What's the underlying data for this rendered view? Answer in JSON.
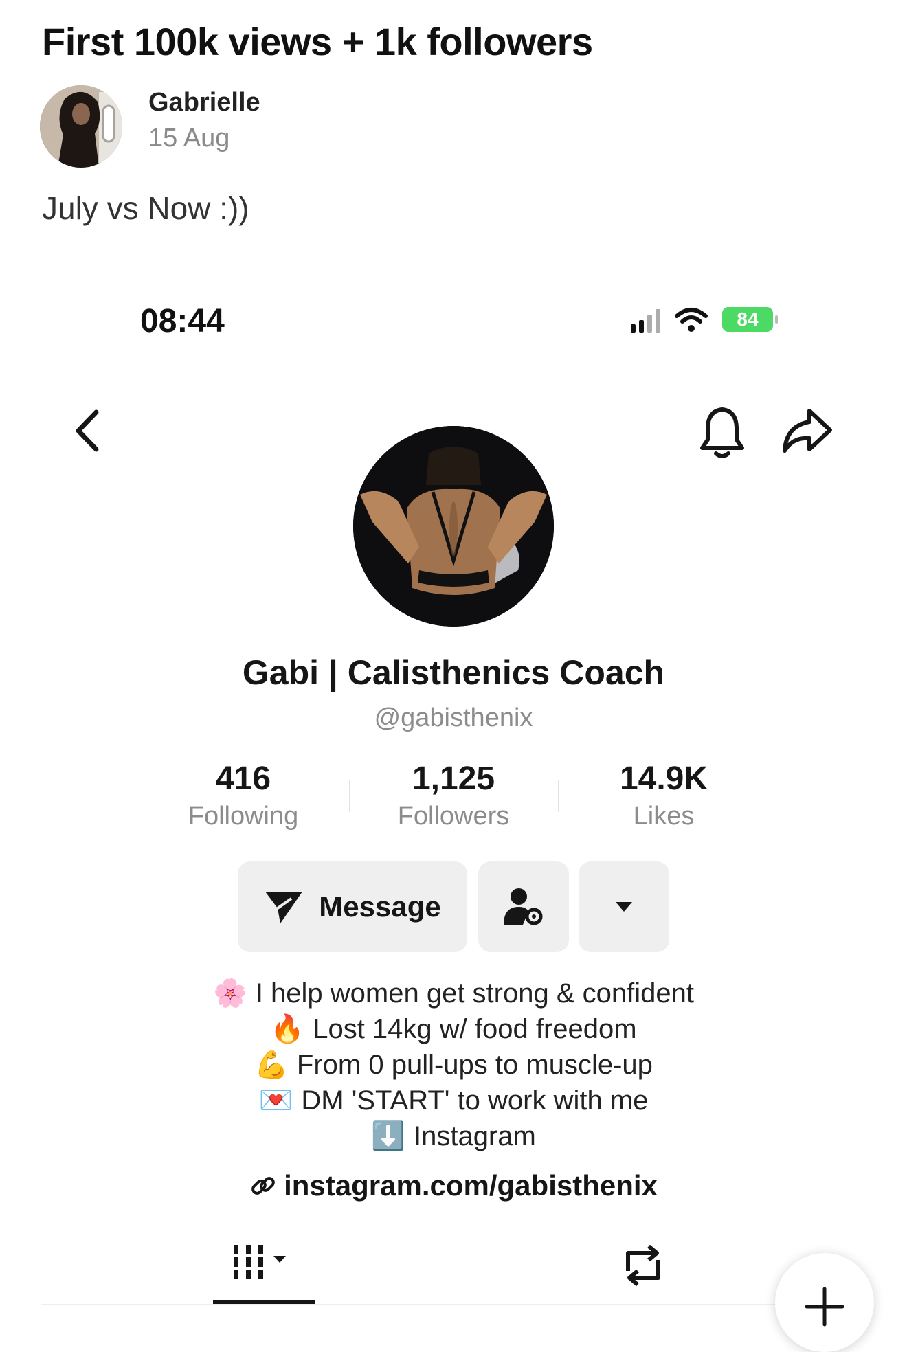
{
  "post": {
    "title": "First 100k views + 1k followers",
    "author": "Gabrielle",
    "date": "15 Aug",
    "body": "July vs Now :))"
  },
  "status_bar": {
    "time": "08:44",
    "battery": "84"
  },
  "profile": {
    "display_name": "Gabi | Calisthenics Coach",
    "handle": "@gabisthenix",
    "stats": [
      {
        "value": "416",
        "label": "Following"
      },
      {
        "value": "1,125",
        "label": "Followers"
      },
      {
        "value": "14.9K",
        "label": "Likes"
      }
    ],
    "message_button": "Message",
    "bio": [
      {
        "emoji": "🌸",
        "text": "I help women get strong & confident"
      },
      {
        "emoji": "🔥",
        "text": "Lost 14kg w/ food freedom"
      },
      {
        "emoji": "💪",
        "text": "From 0 pull-ups to muscle-up"
      },
      {
        "emoji": "💌",
        "text": "DM 'START' to work with me"
      },
      {
        "emoji": "⬇️",
        "text": "Instagram"
      }
    ],
    "link": "instagram.com/gabisthenix"
  },
  "icons": {
    "back": "chevron-left-icon",
    "bell": "bell-icon",
    "share": "share-arrow-icon",
    "message": "paper-plane-icon",
    "friend_settings": "person-gear-icon",
    "more": "caret-down-icon",
    "link": "link-icon",
    "grid_tab": "grid-icon",
    "repost_tab": "repost-icon",
    "fab": "plus-icon"
  },
  "colors": {
    "battery": "#4cd964",
    "button_bg": "#efefef",
    "muted_text": "#8c8c8c"
  }
}
